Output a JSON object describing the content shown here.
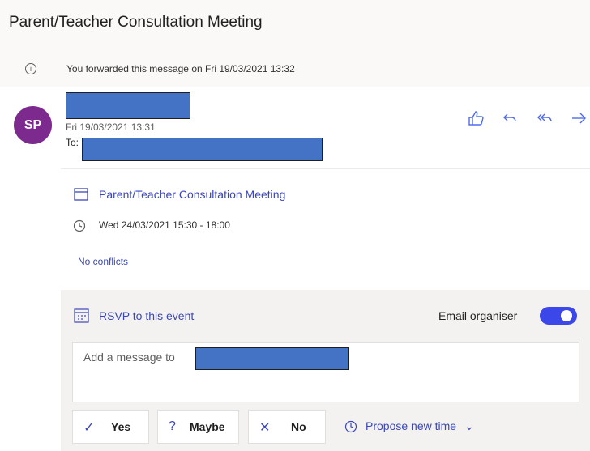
{
  "message": {
    "subject": "Parent/Teacher Consultation Meeting",
    "forward_info": "You forwarded this message on Fri 19/03/2021 13:32",
    "avatar_initials": "SP",
    "sent_date": "Fri 19/03/2021 13:31",
    "to_label": "To:",
    "icons": [
      "info-icon",
      "like-icon",
      "reply-icon",
      "reply-all-icon",
      "forward-icon"
    ]
  },
  "event": {
    "title": "Parent/Teacher Consultation Meeting",
    "time": "Wed 24/03/2021 15:30 - 18:00",
    "conflicts": "No conflicts"
  },
  "rsvp": {
    "label": "RSVP to this event",
    "email_organiser_label": "Email organiser",
    "email_organiser_on": true,
    "message_placeholder": "Add a message to",
    "buttons": {
      "yes": "Yes",
      "maybe": "Maybe",
      "no": "No",
      "propose": "Propose new time"
    }
  },
  "colors": {
    "accent": "#3b47b8",
    "avatar": "#7d2a8f",
    "redaction": "#4472c4",
    "toggle": "#3b47e8"
  }
}
